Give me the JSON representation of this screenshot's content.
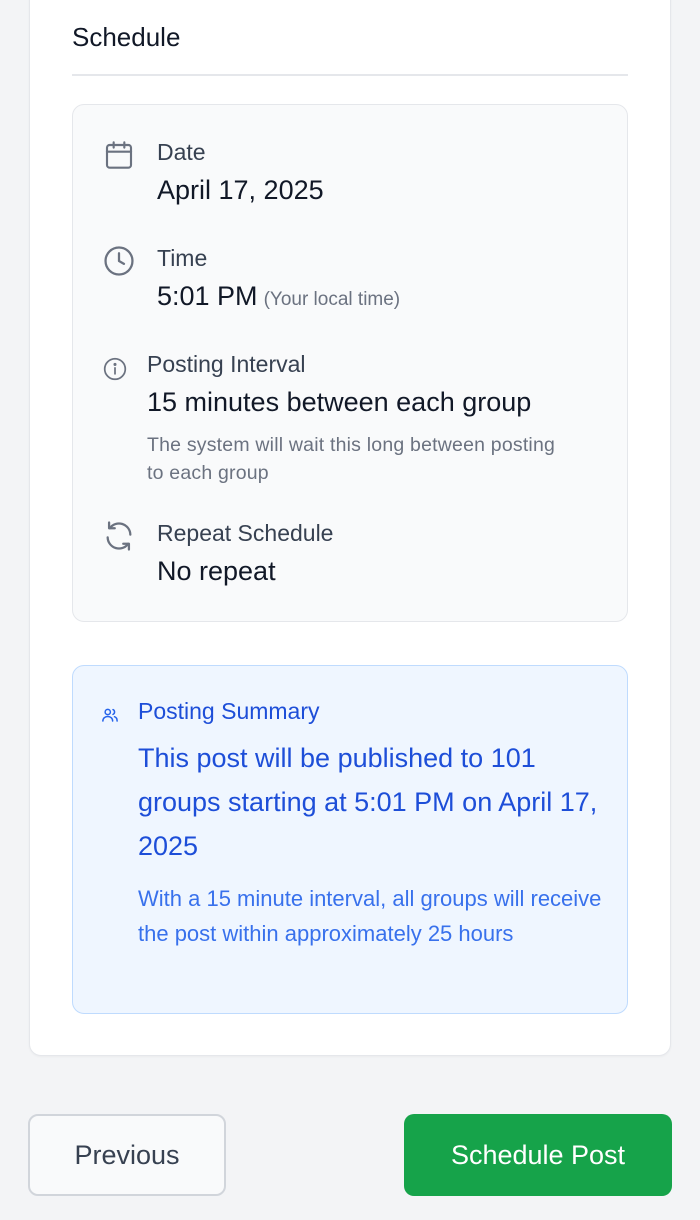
{
  "section": {
    "title": "Schedule"
  },
  "details": {
    "date": {
      "label": "Date",
      "value": "April 17, 2025",
      "icon": "calendar-icon"
    },
    "time": {
      "label": "Time",
      "value": "5:01 PM",
      "note": "(Your local time)",
      "icon": "clock-icon"
    },
    "interval": {
      "label": "Posting Interval",
      "value": "15 minutes between each group",
      "help": "The system will wait this long between posting to each group",
      "icon": "info-icon"
    },
    "repeat": {
      "label": "Repeat Schedule",
      "value": "No repeat",
      "icon": "refresh-icon"
    }
  },
  "summary": {
    "icon": "users-icon",
    "title": "Posting Summary",
    "main": "This post will be published to 101 groups starting at 5:01 PM on April 17, 2025",
    "sub": "With a 15 minute interval, all groups will receive the post within approximately 25 hours"
  },
  "actions": {
    "previous_label": "Previous",
    "schedule_label": "Schedule Post"
  },
  "colors": {
    "accent_green": "#16a34a",
    "summary_blue": "#1d4ed8",
    "summary_bg": "#eff6ff"
  }
}
